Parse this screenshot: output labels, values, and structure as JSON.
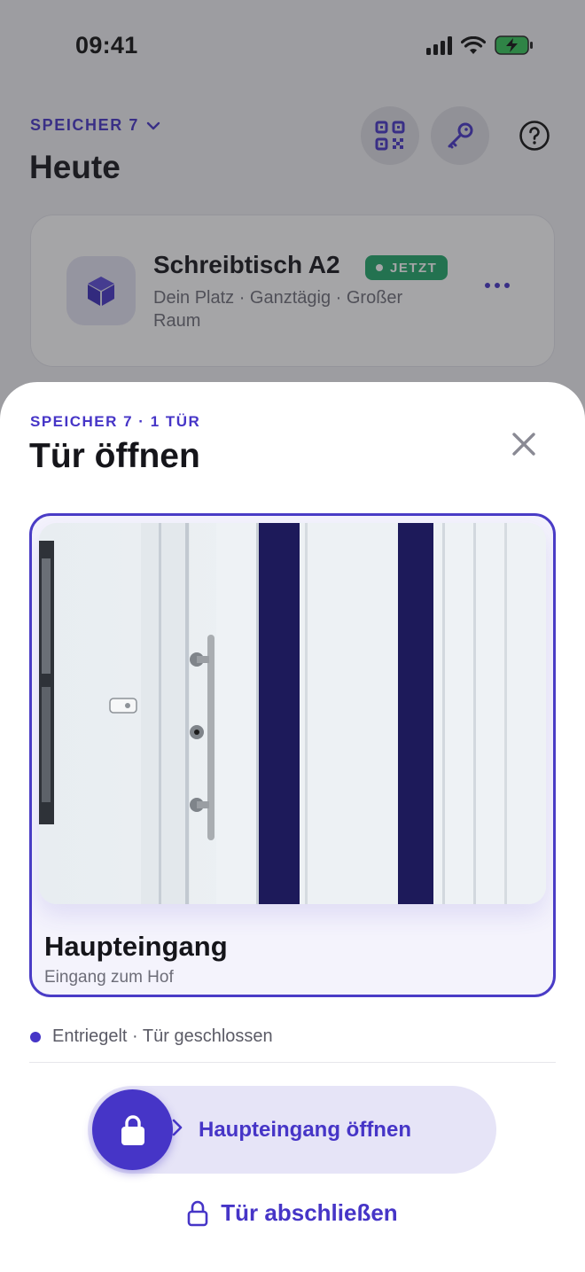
{
  "status_bar": {
    "time": "09:41"
  },
  "background": {
    "space_switcher": "SPEICHER 7",
    "title": "Heute",
    "buttons": {
      "qr": "qr-code-icon",
      "key": "key-icon",
      "help": "help-icon"
    },
    "booking": {
      "title": "Schreibtisch A2",
      "badge": "JETZT",
      "subtitle": "Dein Platz · Ganztägig · Großer Raum",
      "icon": "cube-icon"
    }
  },
  "sheet": {
    "eyebrow": "SPEICHER 7 · 1 TÜR",
    "title": "Tür öffnen",
    "door": {
      "name": "Haupteingang",
      "description": "Eingang zum Hof"
    },
    "status": "Entriegelt · Tür geschlossen",
    "slide_label": "Haupteingang öffnen",
    "lock_label": "Tür abschließen"
  },
  "colors": {
    "accent": "#4635c7",
    "badge_green": "#1fa86a",
    "track": "#e6e4f7"
  }
}
